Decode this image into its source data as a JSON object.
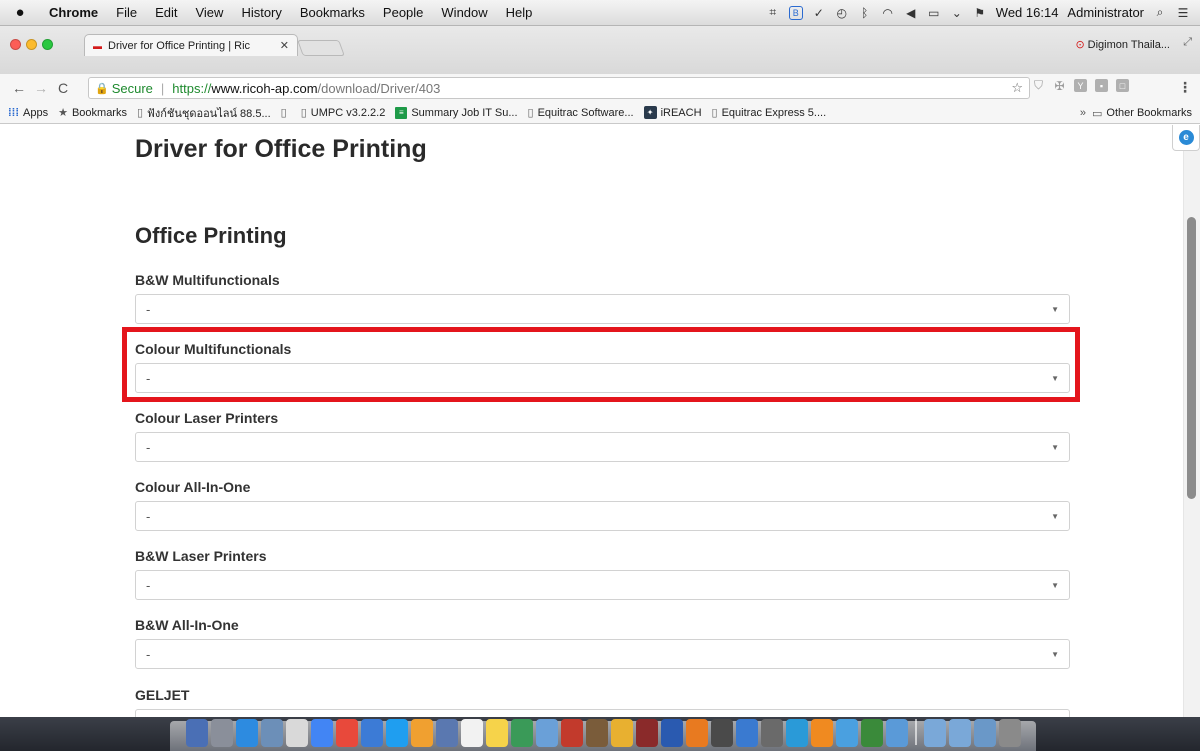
{
  "menubar": {
    "app": "Chrome",
    "items": [
      "File",
      "Edit",
      "View",
      "History",
      "Bookmarks",
      "People",
      "Window",
      "Help"
    ],
    "clock": "Wed 16:14",
    "user": "Administrator"
  },
  "tabs": {
    "active_title": "Driver for Office Printing | Ric",
    "profile_name": "Digimon Thaila..."
  },
  "address": {
    "security_label": "Secure",
    "scheme": "https://",
    "host": "www.ricoh-ap.com",
    "path": "/download/Driver/403"
  },
  "bookmarks": {
    "items": [
      {
        "label": "Apps",
        "icon": "apps-grid-icon"
      },
      {
        "label": "Bookmarks",
        "icon": "star-icon"
      },
      {
        "label": "ฟังก์ชันชุดออนไลน์ 88.5...",
        "icon": "page-icon"
      },
      {
        "label": "",
        "icon": "page-icon"
      },
      {
        "label": "UMPC v3.2.2.2",
        "icon": "page-icon"
      },
      {
        "label": "Summary Job IT Su...",
        "icon": "sheets-icon"
      },
      {
        "label": "Equitrac Software...",
        "icon": "page-icon"
      },
      {
        "label": "iREACH",
        "icon": "ireach-icon"
      },
      {
        "label": "Equitrac Express 5....",
        "icon": "page-icon"
      }
    ],
    "other": "Other Bookmarks"
  },
  "page": {
    "title": "Driver for Office Printing",
    "section": "Office Printing",
    "fields": [
      {
        "label": "B&W Multifunctionals",
        "value": "-"
      },
      {
        "label": "Colour Multifunctionals",
        "value": "-"
      },
      {
        "label": "Colour Laser Printers",
        "value": "-"
      },
      {
        "label": "Colour All-In-One",
        "value": "-"
      },
      {
        "label": "B&W Laser Printers",
        "value": "-"
      },
      {
        "label": "B&W All-In-One",
        "value": "-"
      },
      {
        "label": "GELJET",
        "value": "-"
      }
    ],
    "highlight_color": "#e4151c"
  },
  "dock": {
    "icon_colors": [
      "#4a6fb5",
      "#8a8f9a",
      "#2d8be0",
      "#6c8fb8",
      "#d9d9d9",
      "#4285f4",
      "#e8493b",
      "#3c7bd6",
      "#1f9ef0",
      "#f0a030",
      "#5a78b0",
      "#f2f2f2",
      "#f6d34a",
      "#3a9a58",
      "#6aa0d8",
      "#c23a2c",
      "#7a5c3a",
      "#e8b030",
      "#8a2a2a",
      "#2a5ab0",
      "#e87a20",
      "#4a4a4a",
      "#3a7ad0",
      "#6a6a6a",
      "#2a9ad8",
      "#f08a20",
      "#4aa0e0",
      "#3a8a3a",
      "#5a9ad8"
    ],
    "folder_colors": [
      "#7aa8d8",
      "#7aa8d8",
      "#6a98c8",
      "#8a8a8a"
    ]
  }
}
